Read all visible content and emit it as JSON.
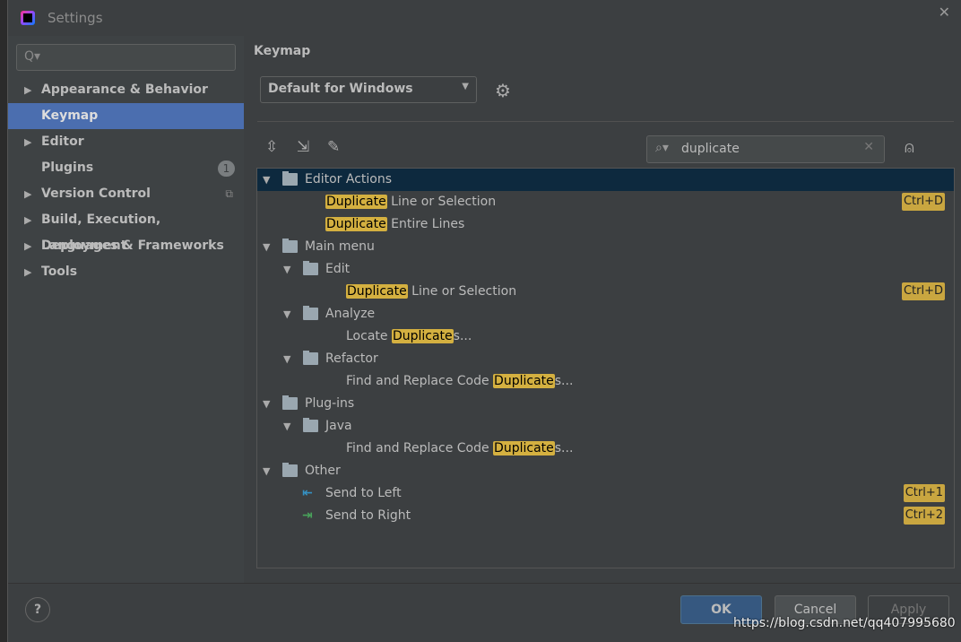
{
  "window": {
    "title": "Settings",
    "close": "✕"
  },
  "sidebar": {
    "search_placeholder": "",
    "search_icon": "Q▾",
    "items": [
      {
        "label": "Appearance & Behavior",
        "arrow": "▶"
      },
      {
        "label": "Keymap",
        "arrow": ""
      },
      {
        "label": "Editor",
        "arrow": "▶"
      },
      {
        "label": "Plugins",
        "arrow": "",
        "badge": "1"
      },
      {
        "label": "Version Control",
        "arrow": "▶",
        "icon": "⧉"
      },
      {
        "label": "Build, Execution, Deployment",
        "arrow": "▶"
      },
      {
        "label": "Languages & Frameworks",
        "arrow": "▶"
      },
      {
        "label": "Tools",
        "arrow": "▶"
      }
    ]
  },
  "main": {
    "heading": "Keymap",
    "keymap_select": "Default for Windows",
    "search_value": "duplicate"
  },
  "tree": [
    {
      "pre": "",
      "hl": "",
      "post": "Editor Actions",
      "level": 0,
      "type": "group"
    },
    {
      "pre": "",
      "hl": "Duplicate",
      "post": " Line or Selection",
      "shortcut": "Ctrl+D"
    },
    {
      "pre": "",
      "hl": "Duplicate",
      "post": " Entire Lines"
    },
    {
      "pre": "",
      "hl": "",
      "post": "Main menu",
      "type": "group"
    },
    {
      "pre": "",
      "hl": "",
      "post": "Edit",
      "type": "folder"
    },
    {
      "pre": "",
      "hl": "Duplicate",
      "post": " Line or Selection",
      "shortcut": "Ctrl+D"
    },
    {
      "pre": "",
      "hl": "",
      "post": "Analyze",
      "type": "folder"
    },
    {
      "pre": "Locate ",
      "hl": "Duplicate",
      "post": "s..."
    },
    {
      "pre": "",
      "hl": "",
      "post": "Refactor",
      "type": "folder"
    },
    {
      "pre": "Find and Replace Code ",
      "hl": "Duplicate",
      "post": "s..."
    },
    {
      "pre": "",
      "hl": "",
      "post": "Plug-ins",
      "type": "group"
    },
    {
      "pre": "",
      "hl": "",
      "post": "Java",
      "type": "folder"
    },
    {
      "pre": "Find and Replace Code ",
      "hl": "Duplicate",
      "post": "s..."
    },
    {
      "pre": "",
      "hl": "",
      "post": "Other",
      "type": "group"
    },
    {
      "pre": "",
      "hl": "",
      "post": "Send to Left",
      "shortcut": "Ctrl+1"
    },
    {
      "pre": "",
      "hl": "",
      "post": "Send to Right",
      "shortcut": "Ctrl+2"
    }
  ],
  "footer": {
    "help": "?",
    "ok": "OK",
    "cancel": "Cancel",
    "apply": "Apply"
  },
  "watermark": "https://blog.csdn.net/qq407995680",
  "colors": {
    "selection": "#4b6eaf",
    "tree_selection": "#0d293e",
    "highlight": "#d4b040"
  }
}
